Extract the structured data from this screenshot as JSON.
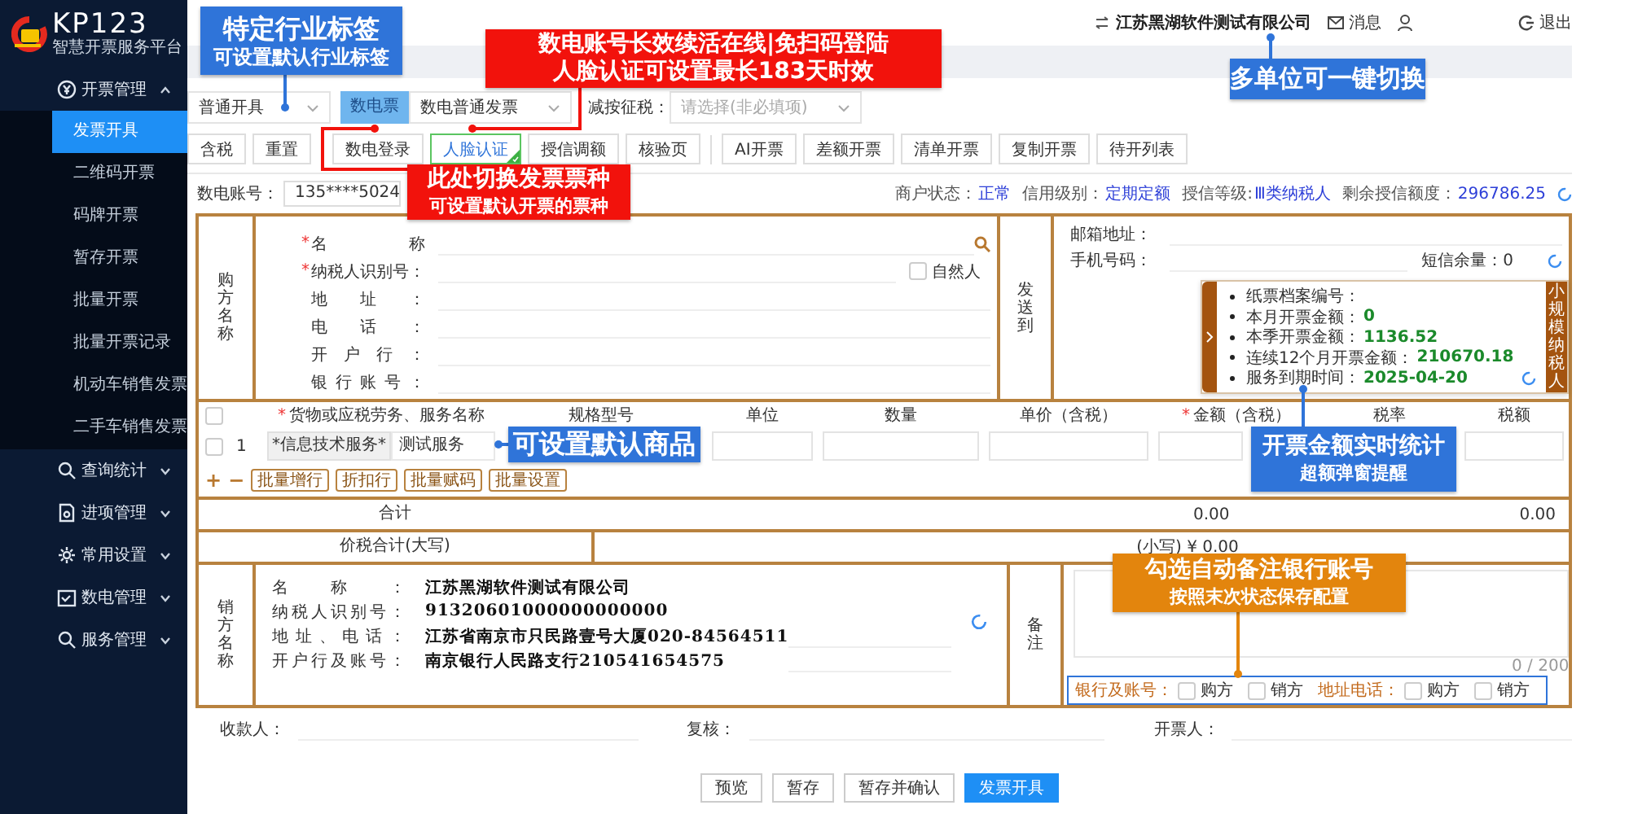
{
  "sidebar": {
    "logo": "KP123",
    "subtitle": "智慧开票服务平台",
    "groups": [
      {
        "label": "开票管理",
        "expanded": true,
        "children": [
          {
            "label": "发票开具",
            "selected": true
          },
          {
            "label": "二维码开票",
            "selected": false
          },
          {
            "label": "码牌开票",
            "selected": false
          },
          {
            "label": "暂存开票",
            "selected": false
          },
          {
            "label": "批量开票",
            "selected": false
          },
          {
            "label": "批量开票记录",
            "selected": false
          },
          {
            "label": "机动车销售发票",
            "selected": false
          },
          {
            "label": "二手车销售发票",
            "selected": false
          }
        ]
      },
      {
        "label": "查询统计",
        "expanded": false
      },
      {
        "label": "进项管理",
        "expanded": false
      },
      {
        "label": "常用设置",
        "expanded": false
      },
      {
        "label": "数电管理",
        "expanded": false
      },
      {
        "label": "服务管理",
        "expanded": false
      }
    ]
  },
  "header": {
    "company": "江苏黑湖软件测试有限公司",
    "messages": "消息",
    "logout": "退出"
  },
  "filters": {
    "mode": "普通开具",
    "tag": "数电票",
    "invoice_type": "数电普通发票",
    "reduced_tax_label": "减按征税：",
    "reduced_tax_placeholder": "请选择(非必填项)"
  },
  "toolbar": [
    {
      "buttons": [
        {
          "label": "含税",
          "selected": false
        },
        {
          "label": "重置",
          "selected": false
        }
      ]
    },
    {
      "buttons": [
        {
          "label": "数电登录",
          "selected": false
        },
        {
          "label": "人脸认证",
          "selected": true
        },
        {
          "label": "授信调额",
          "selected": false
        },
        {
          "label": "核验页",
          "selected": false
        }
      ]
    },
    {
      "buttons": [
        {
          "label": "AI开票",
          "selected": false
        },
        {
          "label": "差额开票",
          "selected": false
        },
        {
          "label": "清单开票",
          "selected": false
        },
        {
          "label": "复制开票",
          "selected": false
        },
        {
          "label": "待开列表",
          "selected": false
        }
      ]
    }
  ],
  "account": {
    "label": "数电账号：",
    "value": "135****5024"
  },
  "status": [
    {
      "label": "商户状态：",
      "value": "正常"
    },
    {
      "label": "信用级别：",
      "value": "定期定额"
    },
    {
      "label": "授信等级:",
      "value": "Ⅲ类纳税人"
    },
    {
      "label": "剩余授信额度：",
      "value": "296786.25"
    }
  ],
  "buyer": {
    "title": "购方名称",
    "fields": [
      {
        "label": "名称",
        "required_mark": "*"
      },
      {
        "label": "纳税人识别号：",
        "required_mark": "*"
      },
      {
        "label": "地址："
      },
      {
        "label": "电话："
      },
      {
        "label": "开户行："
      },
      {
        "label": "银行账号："
      }
    ],
    "natural_person": {
      "label": "自然人",
      "checked": false
    }
  },
  "send_to": {
    "title": "发送到",
    "email_label": "邮箱地址：",
    "phone_label": "手机号码：",
    "sms_balance": "短信余量：0"
  },
  "stats": {
    "items": [
      {
        "label": "纸票档案编号："
      },
      {
        "label": "本月开票金额：",
        "value": "0"
      },
      {
        "label": "本季开票金额：",
        "value": "1136.52"
      },
      {
        "label": "连续12个月开票金额：",
        "value": "210670.18"
      },
      {
        "label": "服务到期时间：",
        "value": "2025-04-20"
      }
    ],
    "taxpayer_type": "小规模纳税人"
  },
  "items": {
    "select_all": {
      "checked": false
    },
    "columns": [
      {
        "label": "货物或应税劳务、服务名称",
        "required_mark": "*"
      },
      {
        "label": "规格型号"
      },
      {
        "label": "单位"
      },
      {
        "label": "数量"
      },
      {
        "label": "单价（含税）"
      },
      {
        "label": "金额（含税）",
        "required_mark": "*"
      },
      {
        "label": "税率"
      },
      {
        "label": "税额"
      }
    ],
    "rows": [
      {
        "checked": false,
        "no": "1",
        "category": "*信息技术服务*",
        "name": "测试服务"
      }
    ],
    "add": "+",
    "remove": "−",
    "actions": [
      "批量增行",
      "折扣行",
      "批量赋码",
      "批量设置"
    ]
  },
  "totals": {
    "label": "合计",
    "amount": "0.00",
    "tax": "0.00"
  },
  "grand_total": {
    "label": "价税合计(大写)",
    "small": "(小写) ¥ 0.00"
  },
  "seller": {
    "title": "销方名称",
    "fields": [
      {
        "label": "名称：",
        "value": "江苏黑湖软件测试有限公司"
      },
      {
        "label": "纳税人识别号：",
        "value": "91320601000000000000"
      },
      {
        "label": "地址、电话：",
        "value": "江苏省南京市只民路壹号大厦020-84564511"
      },
      {
        "label": "开户行及账号：",
        "value": "南京银行人民路支行210541654575"
      }
    ]
  },
  "remark": {
    "title": "备注",
    "counter": "0 / 200",
    "options": [
      {
        "label": "银行及账号：",
        "choices": [
          {
            "label": "购方",
            "checked": false
          },
          {
            "label": "销方",
            "checked": false
          }
        ]
      },
      {
        "label": "地址电话：",
        "choices": [
          {
            "label": "购方",
            "checked": false
          },
          {
            "label": "销方",
            "checked": false
          }
        ]
      }
    ]
  },
  "signatures": [
    "收款人：",
    "复核：",
    "开票人："
  ],
  "actions": [
    {
      "label": "预览",
      "primary": false
    },
    {
      "label": "暂存",
      "primary": false
    },
    {
      "label": "暂存并确认",
      "primary": false
    },
    {
      "label": "发票开具",
      "primary": true
    }
  ],
  "callouts": [
    {
      "lines": [
        "特定行业标签",
        "可设置默认行业标签"
      ],
      "color": "#2f74d9"
    },
    {
      "lines": [
        "数电账号长效续活在线|免扫码登陆",
        "人脸认证可设置最长183天时效"
      ],
      "color": "#f2120c"
    },
    {
      "lines": [
        "此处切换发票票种",
        "可设置默认开票的票种"
      ],
      "color": "#f2120c"
    },
    {
      "lines": [
        "多单位可一键切换"
      ],
      "color": "#2f74d9"
    },
    {
      "lines": [
        "可设置默认商品"
      ],
      "color": "#2f74d9"
    },
    {
      "lines": [
        "开票金额实时统计",
        "超额弹窗提醒"
      ],
      "color": "#2f74d9"
    },
    {
      "lines": [
        "勾选自动备注银行账号",
        "按照末次状态保存配置"
      ],
      "color": "#e3850d"
    }
  ]
}
